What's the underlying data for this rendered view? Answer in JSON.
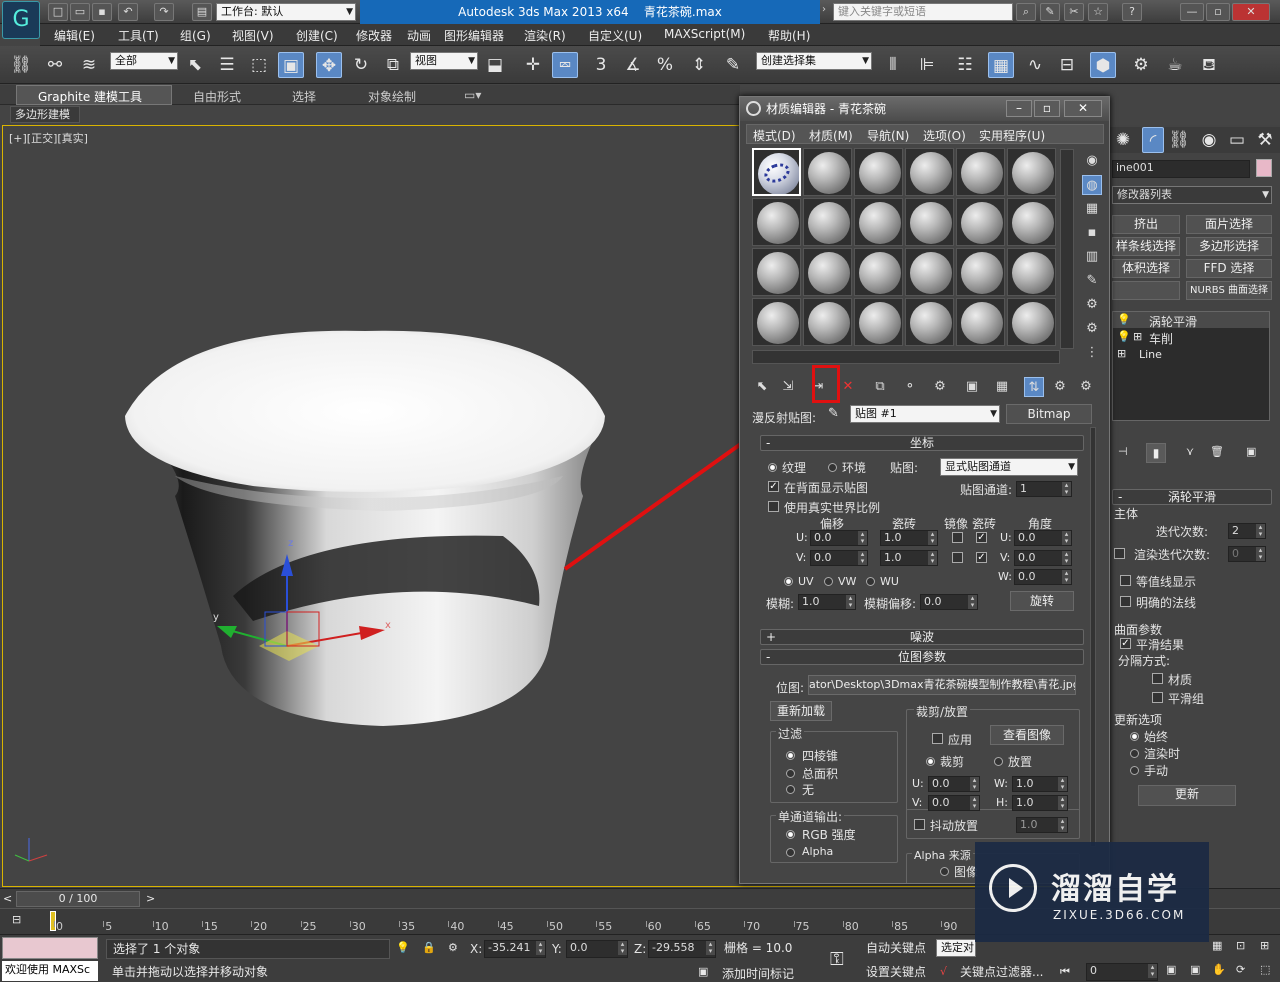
{
  "titlebar": {
    "workspace_label": "工作台: 默认",
    "app_title": "Autodesk 3ds Max  2013 x64",
    "file_name": "青花茶碗.max",
    "search_placeholder": "键入关键字或短语"
  },
  "menus": [
    "编辑(E)",
    "工具(T)",
    "组(G)",
    "视图(V)",
    "创建(C)",
    "修改器",
    "动画",
    "图形编辑器",
    "渲染(R)",
    "自定义(U)",
    "MAXScript(M)",
    "帮助(H)"
  ],
  "toolbar": {
    "filter": "全部",
    "refcoord": "视图",
    "selection_set": "创建选择集",
    "snap_num": "3"
  },
  "ribbon": {
    "tabs": [
      "Graphite 建模工具",
      "自由形式",
      "选择",
      "对象绘制"
    ],
    "sub": "多边形建模"
  },
  "viewport": {
    "label": "[+][正交][真实]",
    "axis_x": "x",
    "axis_y": "y",
    "axis_z": "z"
  },
  "med": {
    "title": "材质编辑器 - 青花茶碗",
    "menus": [
      "模式(D)",
      "材质(M)",
      "导航(N)",
      "选项(O)",
      "实用程序(U)"
    ],
    "map_label": "漫反射贴图:",
    "map_name": "贴图 #1",
    "map_type": "Bitmap",
    "coords": {
      "head": "坐标",
      "texture": "纹理",
      "environ": "环境",
      "mapping_label": "贴图:",
      "mapping": "显式贴图通道",
      "show_back": "在背面显示贴图",
      "channel_label": "贴图通道:",
      "channel": "1",
      "realworld": "使用真实世界比例",
      "offset": "偏移",
      "tiling": "瓷砖",
      "mirror": "镜像",
      "tile": "瓷砖",
      "angle": "角度",
      "u": "U:",
      "v": "V:",
      "w": "W:",
      "u_off": "0.0",
      "v_off": "0.0",
      "u_til": "1.0",
      "v_til": "1.0",
      "u_ang": "0.0",
      "v_ang": "0.0",
      "w_ang": "0.0",
      "uv": "UV",
      "vw": "VW",
      "wu": "WU",
      "blur_label": "模糊:",
      "blur": "1.0",
      "blur_off_label": "模糊偏移:",
      "blur_off": "0.0",
      "rotate": "旋转"
    },
    "noise_head": "噪波",
    "bitmap": {
      "head": "位图参数",
      "path_label": "位图:",
      "path": "ator\\Desktop\\3Dmax青花茶碗模型制作教程\\青花.jpg",
      "reload": "重新加载",
      "crop_group": "裁剪/放置",
      "apply": "应用",
      "view": "查看图像",
      "crop": "裁剪",
      "place": "放置",
      "filter": "过滤",
      "f1": "四棱锥",
      "f2": "总面积",
      "f3": "无",
      "u": "U:",
      "v": "V:",
      "w": "W:",
      "h": "H:",
      "cu": "0.0",
      "cv": "0.0",
      "cw": "1.0",
      "ch": "1.0",
      "jitter": "抖动放置",
      "jitter_v": "1.0",
      "mono": "单通道输出:",
      "rgb": "RGB 强度",
      "alpha": "Alpha",
      "alpha_src": "Alpha 来源",
      "alpha_img": "图像"
    }
  },
  "cmd": {
    "name": "ine001",
    "modlist": "修改器列表",
    "btns": [
      "挤出",
      "面片选择",
      "样条线选择",
      "多边形选择",
      "体积选择",
      "FFD 选择",
      "",
      "NURBS 曲面选择"
    ],
    "stack": [
      "涡轮平滑",
      "车削",
      "Line"
    ],
    "roll": "涡轮平滑",
    "main": "主体",
    "iter_label": "迭代次数:",
    "iter": "2",
    "render_iter": "渲染迭代次数:",
    "render_iter_v": "0",
    "isoline": "等值线显示",
    "explicit": "明确的法线",
    "surf": "曲面参数",
    "smooth": "平滑结果",
    "sep": "分隔方式:",
    "mat": "材质",
    "sg": "平滑组",
    "update": "更新选项",
    "always": "始终",
    "render": "渲染时",
    "manual": "手动",
    "update_btn": "更新"
  },
  "timeline": {
    "frame": "0 / 100",
    "ticks": [
      "0",
      "5",
      "10",
      "15",
      "20",
      "25",
      "30",
      "35",
      "40",
      "45",
      "50",
      "55",
      "60",
      "65",
      "70",
      "75",
      "80",
      "85",
      "90"
    ]
  },
  "status": {
    "welcome": "欢迎使用 MAXSc",
    "selected": "选择了 1 个对象",
    "hint": "单击并拖动以选择并移动对象",
    "x": "-35.241",
    "y": "0.0",
    "z": "-29.558",
    "grid": "栅格 = 10.0",
    "autokey": "自动关键点",
    "setkey": "设置关键点",
    "sel_obj": "选定对",
    "add_time": "添加时间标记",
    "key_filter": "关键点过滤器...",
    "frame": "0",
    "xl": "X:",
    "yl": "Y:",
    "zl": "Z:"
  },
  "watermark": {
    "brand": "溜溜自学",
    "url": "ZIXUE.3D66.COM"
  }
}
